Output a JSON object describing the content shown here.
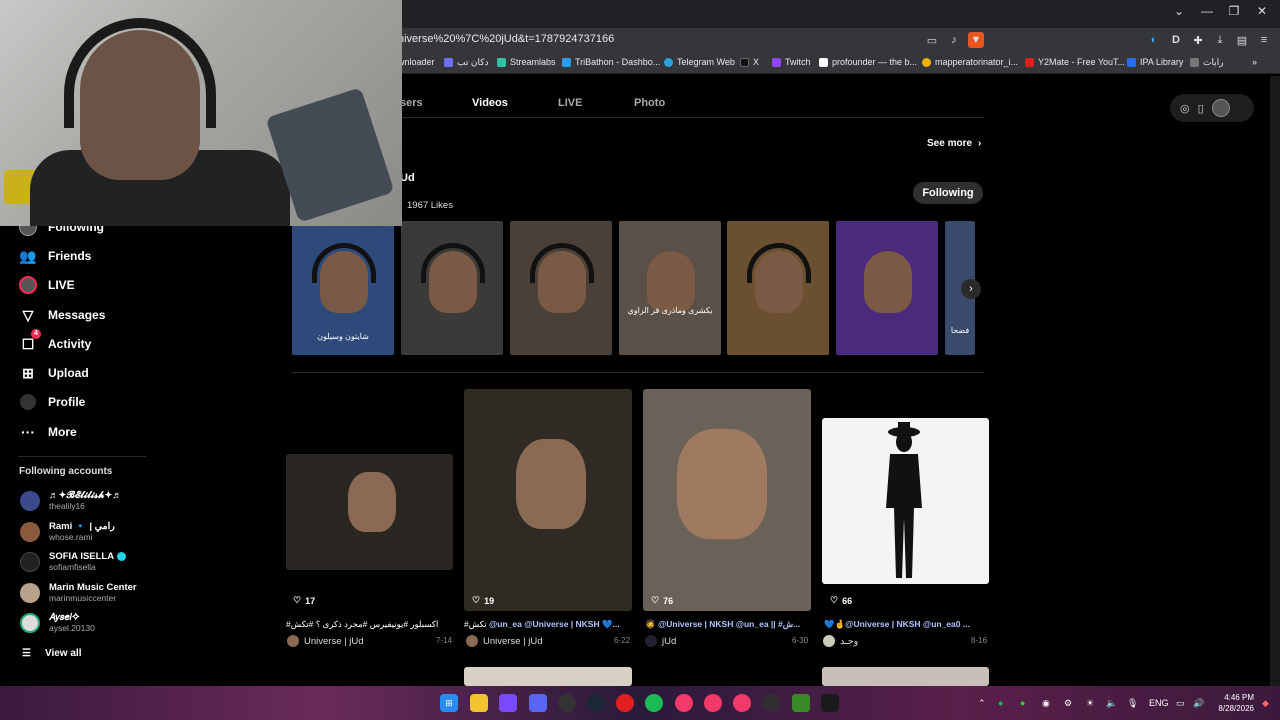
{
  "browser": {
    "url": "niverse%20%7C%20jUd&t=1787924737166",
    "bookmarks": [
      {
        "label": "wnloader",
        "color": "#777"
      },
      {
        "label": "دكان تب",
        "color": "#6e6eff"
      },
      {
        "label": "Streamlabs",
        "color": "#31c3a2"
      },
      {
        "label": "TriBathon - Dashbo...",
        "color": "#2a9df4"
      },
      {
        "label": "Telegram Web",
        "color": "#2aa3e0"
      },
      {
        "label": "X",
        "color": "#111"
      },
      {
        "label": "Twitch",
        "color": "#9146ff"
      },
      {
        "label": "profounder — the b...",
        "color": "#fff"
      },
      {
        "label": "mapperatorinator_i...",
        "color": "#f0b400"
      },
      {
        "label": "Y2Mate - Free YouT...",
        "color": "#e02020"
      },
      {
        "label": "IPA Library",
        "color": "#2a6df4"
      },
      {
        "label": "رابات",
        "color": "#777"
      }
    ]
  },
  "sidebar": {
    "items": [
      {
        "label": "Following",
        "icon": "following-icon"
      },
      {
        "label": "Friends",
        "icon": "friends-icon"
      },
      {
        "label": "LIVE",
        "icon": "live-icon"
      },
      {
        "label": "Messages",
        "icon": "messages-icon"
      },
      {
        "label": "Activity",
        "icon": "activity-icon",
        "badge": "4"
      },
      {
        "label": "Upload",
        "icon": "upload-icon"
      },
      {
        "label": "Profile",
        "icon": "profile-icon"
      },
      {
        "label": "More",
        "icon": "more-icon"
      }
    ],
    "following_title": "Following accounts",
    "accounts": [
      {
        "name": "♬✦𝓑𝓔𝓵𝓲𝓵𝓲𝓼𝓱✦♬",
        "handle": "thealily16",
        "color": "#3b4a8a"
      },
      {
        "name": "Rami 🔹 | رامي",
        "handle": "whose.rami",
        "color": "#8a5a3a"
      },
      {
        "name": "SOFIA ISELLA",
        "handle": "sofiamfisella",
        "color": "#222",
        "verified": true
      },
      {
        "name": "Marin Music Center",
        "handle": "marinmusiccenter",
        "color": "#b9a28a"
      },
      {
        "name": "𝐴𝑦𝑠𝑒𝑙✧",
        "handle": "aysel.20130",
        "color": "#ddd"
      }
    ],
    "view_all": "View all"
  },
  "main": {
    "tabs": [
      "sers",
      "Videos",
      "LIVE",
      "Photo"
    ],
    "see_more": "See more",
    "creator_name": "Ud",
    "likes": "1967 Likes",
    "following_button": "Following",
    "thumbs": [
      {
        "caption": "شايتون وسيلون",
        "bg": "#2d4a7a"
      },
      {
        "caption": "",
        "bg": "#3a3a38"
      },
      {
        "caption": "",
        "bg": "#4a4038"
      },
      {
        "caption": "يكشرى وماذرى قر الزاوي",
        "bg": "#5a5048"
      },
      {
        "caption": "",
        "bg": "#6a5030"
      },
      {
        "caption": "",
        "bg": "#4a2a7a"
      },
      {
        "caption": "فضحا",
        "bg": "#3a4a6a"
      }
    ],
    "cards": [
      {
        "likes": "17",
        "desc_plain": "#اكسبلور #يونيفيرس #مجرد ذكرى ؟ #تكش",
        "desc_hl": "",
        "author": "Universe | jUd",
        "date": "7-14",
        "bg": "#2a2622"
      },
      {
        "likes": "19",
        "desc_plain": "#تكش ",
        "desc_hl": "@un_ea @Universe | NKSH 💙...",
        "author": "Universe | jUd",
        "date": "6-22",
        "bg": "#302a24"
      },
      {
        "likes": "76",
        "desc_plain": "🧔 ",
        "desc_hl": "@Universe | NKSH @un_ea || #ش...",
        "author": "jUd",
        "date": "6-30",
        "bg": "#6a6258"
      },
      {
        "likes": "66",
        "desc_plain": "💙🤞",
        "desc_hl": "@Universe | NKSH @un_ea0 ...",
        "author": "وجـد",
        "date": "8-16",
        "bg": "#f4f4f4"
      }
    ]
  },
  "taskbar": {
    "apps": [
      {
        "icon": "windows-icon",
        "color": "#2a8df4"
      },
      {
        "icon": "folder-icon",
        "color": "#f4c430"
      },
      {
        "icon": "app-icon",
        "color": "#7a4aff"
      },
      {
        "icon": "discord-icon",
        "color": "#5865f2"
      },
      {
        "icon": "github-icon",
        "color": "#333"
      },
      {
        "icon": "steam-icon",
        "color": "#1b2838"
      },
      {
        "icon": "opera-icon",
        "color": "#e02020"
      },
      {
        "icon": "spotify-icon",
        "color": "#1db954"
      },
      {
        "icon": "app-icon",
        "color": "#f23a6a"
      },
      {
        "icon": "app-icon",
        "color": "#f23a6a"
      },
      {
        "icon": "app-icon",
        "color": "#f23a6a"
      },
      {
        "icon": "obs-icon",
        "color": "#302e31"
      },
      {
        "icon": "minecraft-icon",
        "color": "#3a8a2a"
      },
      {
        "icon": "app-icon",
        "color": "#1a1a1a"
      }
    ],
    "lang": "ENG",
    "time": "4:46 PM",
    "date": "8/28/2026"
  }
}
